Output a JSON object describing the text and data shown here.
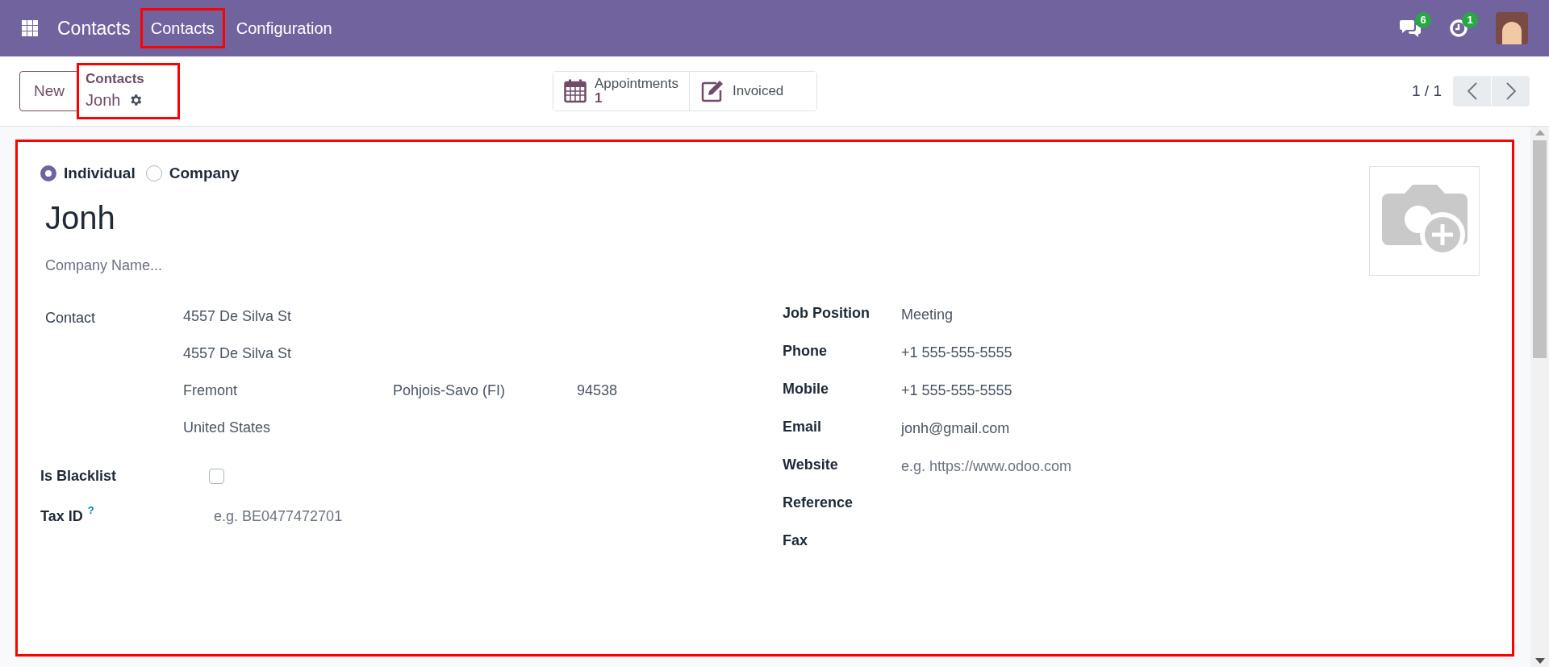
{
  "navbar": {
    "app_title": "Contacts",
    "menus": [
      {
        "label": "Contacts",
        "highlighted": true
      },
      {
        "label": "Configuration",
        "highlighted": false
      }
    ],
    "messages_badge": "6",
    "activities_badge": "1"
  },
  "control_panel": {
    "new_button": "New",
    "breadcrumb": {
      "parent": "Contacts",
      "current": "Jonh",
      "highlighted": true
    },
    "smart_buttons": [
      {
        "kind": "calendar",
        "label": "Appointments",
        "count": "1"
      },
      {
        "kind": "edit",
        "label": "Invoiced"
      }
    ],
    "pager": "1 / 1"
  },
  "form": {
    "highlighted": true,
    "company_type": [
      {
        "label": "Individual",
        "selected": true
      },
      {
        "label": "Company",
        "selected": false
      }
    ],
    "name": "Jonh",
    "company_name": {
      "placeholder": "Company Name..."
    },
    "address": {
      "label": "Contact",
      "street": "4557 De Silva St",
      "street2": "4557 De Silva St",
      "city": "Fremont",
      "state": "Pohjois-Savo (FI)",
      "zip": "94538",
      "country": "United States"
    },
    "blacklist": {
      "label": "Is Blacklist",
      "checked": false
    },
    "tax_id": {
      "label": "Tax ID",
      "help": "?",
      "placeholder": "e.g. BE0477472701"
    },
    "right_fields": [
      {
        "label": "Job Position",
        "value": "Meeting"
      },
      {
        "label": "Phone",
        "value": "+1 555-555-5555"
      },
      {
        "label": "Mobile",
        "value": "+1 555-555-5555"
      },
      {
        "label": "Email",
        "value": "jonh@gmail.com"
      },
      {
        "label": "Website",
        "placeholder": "e.g. https://www.odoo.com"
      },
      {
        "label": "Reference"
      },
      {
        "label": "Fax"
      }
    ]
  }
}
